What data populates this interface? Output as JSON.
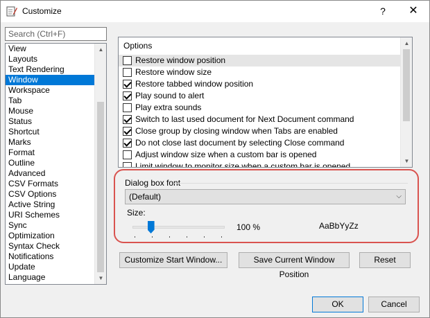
{
  "window": {
    "title": "Customize",
    "help_glyph": "?",
    "close_glyph": "✕"
  },
  "search": {
    "placeholder": "Search (Ctrl+F)"
  },
  "categories": [
    {
      "label": "View"
    },
    {
      "label": "Layouts"
    },
    {
      "label": "Text Rendering"
    },
    {
      "label": "Window",
      "selected": true
    },
    {
      "label": "Workspace"
    },
    {
      "label": "Tab"
    },
    {
      "label": "Mouse"
    },
    {
      "label": "Status"
    },
    {
      "label": "Shortcut"
    },
    {
      "label": "Marks"
    },
    {
      "label": "Format"
    },
    {
      "label": "Outline"
    },
    {
      "label": "Advanced"
    },
    {
      "label": "CSV Formats"
    },
    {
      "label": "CSV Options"
    },
    {
      "label": "Active String"
    },
    {
      "label": "URI Schemes"
    },
    {
      "label": "Sync"
    },
    {
      "label": "Optimization"
    },
    {
      "label": "Syntax Check"
    },
    {
      "label": "Notifications"
    },
    {
      "label": "Update"
    },
    {
      "label": "Language"
    }
  ],
  "options": {
    "header": "Options",
    "items": [
      {
        "label": "Restore window position",
        "checked": false,
        "highlight": true
      },
      {
        "label": "Restore window size",
        "checked": false
      },
      {
        "label": "Restore tabbed window position",
        "checked": true
      },
      {
        "label": "Play sound to alert",
        "checked": true
      },
      {
        "label": "Play extra sounds",
        "checked": false
      },
      {
        "label": "Switch to last used document for Next Document command",
        "checked": true
      },
      {
        "label": "Close group by closing window when Tabs are enabled",
        "checked": true
      },
      {
        "label": "Do not close last document by selecting Close command",
        "checked": true
      },
      {
        "label": "Adjust window size when a custom bar is opened",
        "checked": false
      },
      {
        "label": "Limit window to monitor size when a custom bar is opened",
        "checked": false
      }
    ]
  },
  "font_group": {
    "label": "Dialog box font",
    "selected_font": "(Default)",
    "size_label": "Size:",
    "size_value": "100 %",
    "size_fraction": 0.2,
    "preview_text": "AaBbYyZz"
  },
  "buttons": {
    "customize_start": "Customize Start Window...",
    "save_position": "Save Current Window Position",
    "reset": "Reset",
    "ok": "OK",
    "cancel": "Cancel"
  },
  "colors": {
    "selection": "#0078d7",
    "annotation_outline": "#d9534f"
  }
}
